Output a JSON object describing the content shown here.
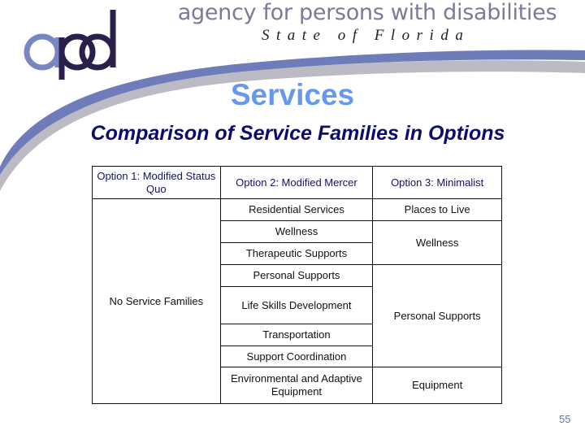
{
  "header": {
    "logo_text": "apd",
    "agency_name": "agency for persons with disabilities",
    "state_name": "State of Florida"
  },
  "slide": {
    "title": "Services",
    "subtitle": "Comparison of Service Families in Options",
    "page_number": "55"
  },
  "table": {
    "headers": [
      "Option 1: Modified Status Quo",
      "Option 2: Modified Mercer",
      "Option 3: Minimalist"
    ],
    "option1": [
      "No Service Families"
    ],
    "option2": [
      "Residential Services",
      "Wellness",
      "Therapeutic Supports",
      "Personal Supports",
      "Life Skills Development",
      "Transportation",
      "Support Coordination",
      "Environmental and Adaptive Equipment"
    ],
    "option3": [
      "Places to Live",
      "Wellness",
      "Personal Supports",
      "Equipment"
    ]
  },
  "colors": {
    "logo_light": "#7a86c0",
    "logo_dark": "#2a1e4a",
    "title": "#6699ee",
    "subtitle": "#0c0c6e",
    "swoosh_blue": "#6f7cba",
    "swoosh_gray": "#b9b7c1"
  }
}
